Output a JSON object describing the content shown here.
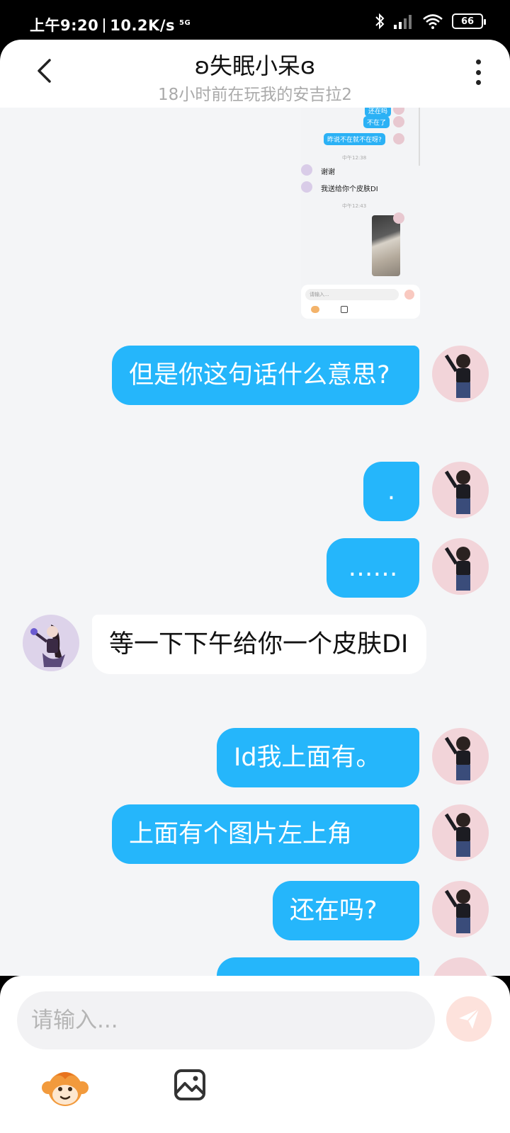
{
  "status": {
    "time": "上午9:20",
    "speed": "10.2K/s",
    "network": "5G",
    "battery": "66"
  },
  "header": {
    "title": "ʚ失眠小呆ɞ",
    "subtitle": "18小时前在玩我的安吉拉2"
  },
  "screenshot": {
    "bubbles": [
      "还在吗",
      "不在了",
      "昨说不在就不在呀?"
    ],
    "time1": "中午12:38",
    "other_msgs": [
      "谢谢",
      "我送给你个皮肤DI"
    ],
    "time2": "中午12:43",
    "input_placeholder": "请输入..."
  },
  "messages": [
    {
      "side": "right",
      "text": "但是你这句话什么意思?"
    },
    {
      "side": "right",
      "text": "."
    },
    {
      "side": "right",
      "text": "……"
    },
    {
      "side": "left",
      "text": "等一下下午给你一个皮肤DI"
    },
    {
      "side": "right",
      "text": "Id我上面有。"
    },
    {
      "side": "right",
      "text": "上面有个图片左上角"
    },
    {
      "side": "right",
      "text": "还在吗?"
    }
  ],
  "input": {
    "placeholder": "请输入..."
  },
  "colors": {
    "my_bubble": "#25b6fb",
    "other_bubble": "#ffffff",
    "chat_bg": "#f4f5f7",
    "send_button": "#fde2dc"
  }
}
